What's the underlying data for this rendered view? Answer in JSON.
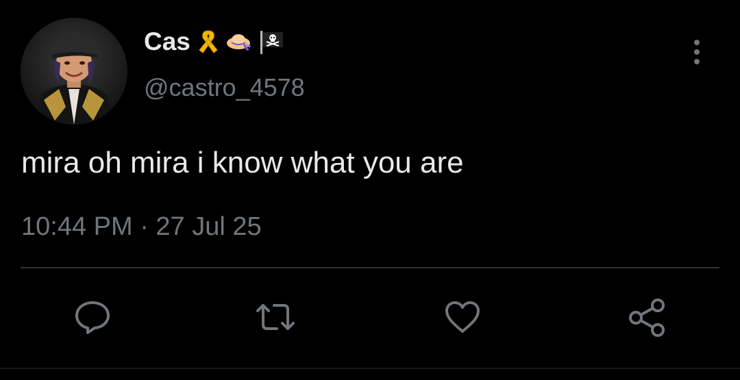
{
  "tweet": {
    "author": {
      "display_name": "Cas",
      "handle": "@castro_4578",
      "name_emojis": [
        "yellow-ribbon-emoji",
        "womans-hat-emoji",
        "pirate-flag-emoji"
      ]
    },
    "text": "mira oh mira i know what you are",
    "timestamp": "10:44 PM · 27 Jul 25",
    "actions": [
      "reply-icon",
      "retweet-icon",
      "like-icon",
      "share-icon"
    ]
  },
  "colors": {
    "background": "#000000",
    "primary_text": "#e7e9ea",
    "secondary_text": "#71767b",
    "divider": "#2f3336",
    "icon": "#71767b"
  }
}
